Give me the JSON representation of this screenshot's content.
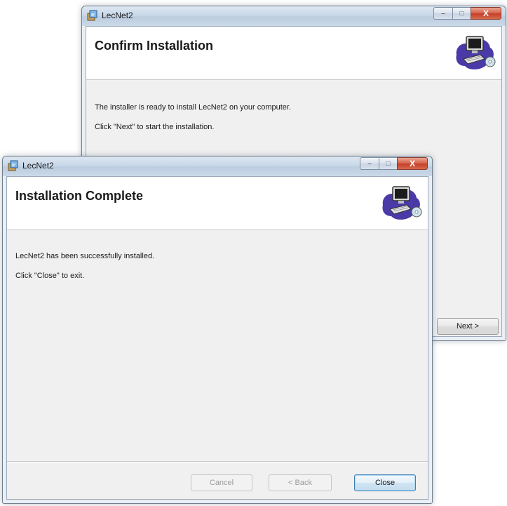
{
  "back_window": {
    "title": "LecNet2",
    "heading": "Confirm Installation",
    "messages": [
      "The installer is ready to install LecNet2 on your computer.",
      "Click \"Next\" to start the installation."
    ],
    "next_label": "Next >"
  },
  "front_window": {
    "title": "LecNet2",
    "heading": "Installation Complete",
    "messages": [
      "LecNet2 has been successfully installed.",
      "Click \"Close\" to exit."
    ],
    "cancel_label": "Cancel",
    "back_label": "< Back",
    "close_label": "Close"
  },
  "caption_glyphs": {
    "minimize": "–",
    "maximize": "□",
    "close": "X"
  },
  "colors": {
    "titlebar": "#c9d8e8",
    "close_button": "#c6402a",
    "default_button_border": "#3c7fb1"
  },
  "icons": {
    "app": "installer-icon",
    "banner": "computer-setup-icon"
  }
}
